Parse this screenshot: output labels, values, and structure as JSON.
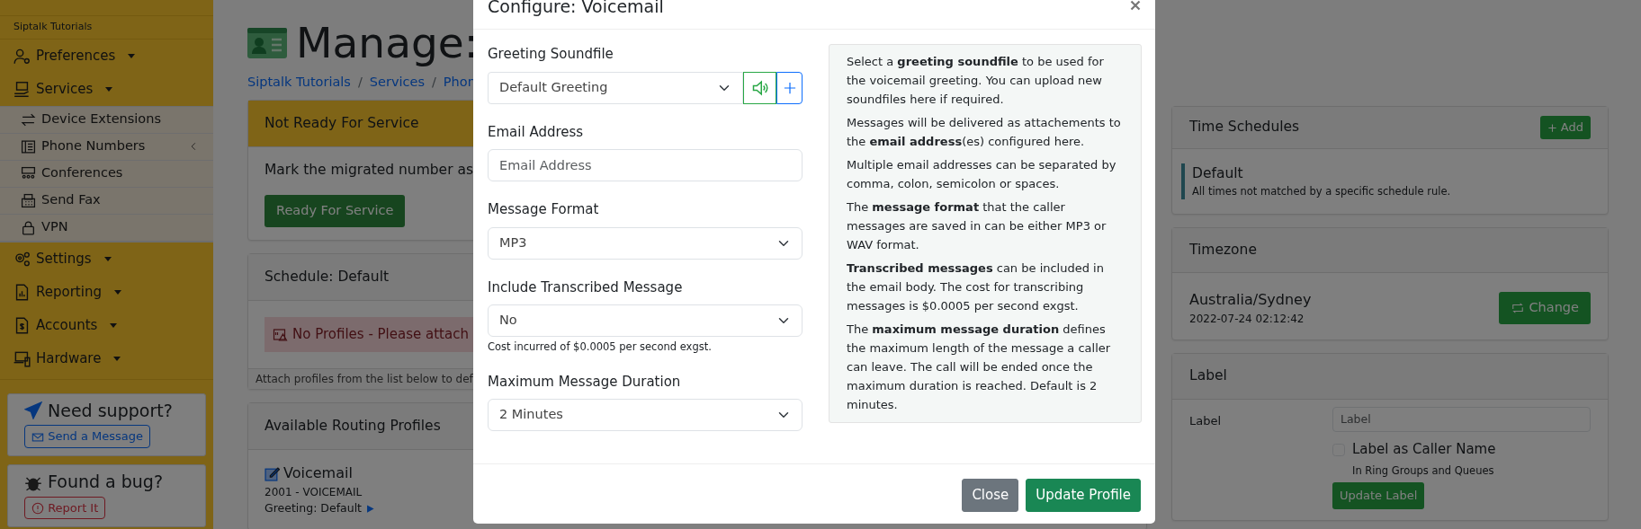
{
  "sidebar": {
    "org": "Siptalk Tutorials",
    "items": [
      {
        "label": "Preferences"
      },
      {
        "label": "Services",
        "children": [
          {
            "label": "Device Extensions"
          },
          {
            "label": "Phone Numbers"
          },
          {
            "label": "Conferences"
          },
          {
            "label": "Send Fax"
          },
          {
            "label": "VPN"
          }
        ]
      },
      {
        "label": "Settings"
      },
      {
        "label": "Reporting"
      },
      {
        "label": "Accounts"
      },
      {
        "label": "Hardware"
      }
    ],
    "support": {
      "title": "Need support?",
      "button": "Send a Message"
    },
    "bug": {
      "title": "Found a bug?",
      "button": "Report It"
    }
  },
  "page": {
    "title": "Manage:",
    "breadcrumb_separator": "/",
    "breadcrumb": [
      "Siptalk Tutorials",
      "Services",
      "Phon"
    ],
    "status_card": {
      "title": "Not Ready For Service",
      "text": "Mark the migrated number as",
      "button": "Ready For Service"
    },
    "schedule_card": {
      "title": "Schedule: Default",
      "alert": "No Profiles - Please attach",
      "footer": "Attach profiles from the list below to def"
    },
    "profiles_card": {
      "title": "Available Routing Profiles",
      "profiles": [
        {
          "name": "Voicemail",
          "number": "2001 - VOICEMAIL",
          "greeting": "Greeting: Default"
        }
      ]
    }
  },
  "right": {
    "time_schedules": {
      "title": "Time Schedules",
      "button": "Add",
      "schedules": [
        {
          "name": "Default",
          "description": "All times not matched by a specific schedule rule."
        }
      ]
    },
    "timezone": {
      "title": "Timezone",
      "zone": "Australia/Sydney",
      "time": "2022-07-24 02:12:42",
      "button": "Change"
    },
    "label_card": {
      "title": "Label",
      "field_label": "Label",
      "placeholder": "Label",
      "checkbox": {
        "label": "Label as Caller Name",
        "checked": false
      },
      "hint": "In Ring Groups and Queues",
      "button": "Update Label"
    }
  },
  "modal": {
    "title": "Configure: Voicemail",
    "fields": [
      {
        "kind": "select",
        "label": "Greeting Soundfile",
        "value": "Default Greeting",
        "addons": true
      },
      {
        "kind": "input",
        "label": "Email Address",
        "placeholder": "Email Address"
      },
      {
        "kind": "select",
        "label": "Message Format",
        "value": "MP3"
      },
      {
        "kind": "select",
        "label": "Include Transcribed Message",
        "value": "No",
        "help": "Cost incurred of $0.0005 per second exgst."
      },
      {
        "kind": "select",
        "label": "Maximum Message Duration",
        "value": "2 Minutes"
      }
    ],
    "help": [
      "Select a **greeting soundfile** to be used for the voicemail greeting. You can upload new soundfiles here if required.",
      "Messages will be delivered as attachements to the **email address**(es) configured here.",
      "Multiple email addresses can be separated by comma, colon, semicolon or spaces.",
      "The **message format** that the caller messages are saved in can be either MP3 or WAV format.",
      "**Transcribed messages** can be included in the email body. The cost for transcribing messages is $0.0005 per second exgst.",
      "The **maximum message duration** defines the maximum length of the message a caller can leave. The call will be ended once the maximum duration is reached. Default is 2 minutes."
    ],
    "buttons": [
      {
        "kind": "secondary",
        "label": "Close"
      },
      {
        "kind": "success",
        "label": "Update Profile"
      }
    ]
  }
}
